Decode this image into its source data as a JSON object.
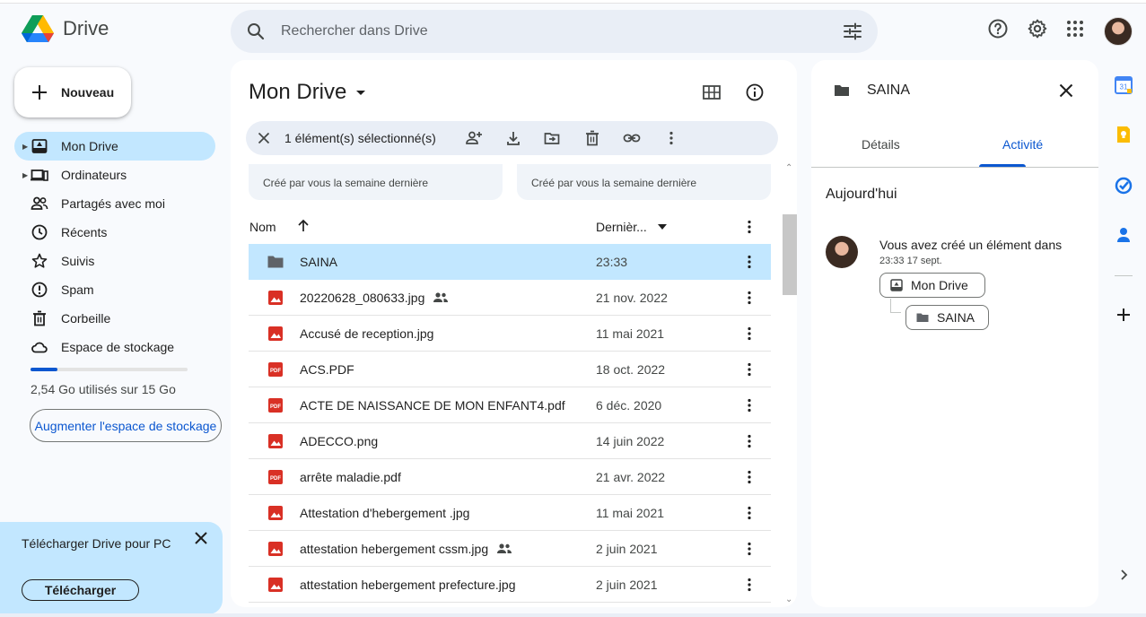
{
  "app": {
    "name": "Drive"
  },
  "search": {
    "placeholder": "Rechercher dans Drive"
  },
  "sidebar": {
    "new_label": "Nouveau",
    "items": [
      {
        "label": "Mon Drive",
        "icon": "my-drive-icon",
        "active": true,
        "expandable": true
      },
      {
        "label": "Ordinateurs",
        "icon": "computers-icon",
        "active": false,
        "expandable": true
      },
      {
        "label": "Partagés avec moi",
        "icon": "shared-icon",
        "active": false
      },
      {
        "label": "Récents",
        "icon": "clock-icon",
        "active": false
      },
      {
        "label": "Suivis",
        "icon": "star-icon",
        "active": false
      },
      {
        "label": "Spam",
        "icon": "spam-icon",
        "active": false
      },
      {
        "label": "Corbeille",
        "icon": "trash-icon",
        "active": false
      },
      {
        "label": "Espace de stockage",
        "icon": "cloud-icon",
        "active": false
      }
    ],
    "storage_used_fraction": 0.17,
    "storage_text": "2,54 Go utilisés sur 15 Go",
    "storage_button": "Augmenter l'espace de stockage"
  },
  "promo": {
    "text": "Télécharger Drive pour PC",
    "button": "Télécharger"
  },
  "main": {
    "title": "Mon Drive",
    "selection_text": "1 élément(s) sélectionné(s)",
    "cards": [
      {
        "caption": "Créé par vous la semaine dernière"
      },
      {
        "caption": "Créé par vous la semaine dernière"
      }
    ],
    "columns": {
      "name": "Nom",
      "date": "Dernièr..."
    },
    "rows": [
      {
        "name": "SAINA",
        "type": "folder",
        "date": "23:33",
        "shared": false,
        "selected": true
      },
      {
        "name": "20220628_080633.jpg",
        "type": "image",
        "date": "21 nov. 2022",
        "shared": true,
        "selected": false
      },
      {
        "name": "Accusé de reception.jpg",
        "type": "image",
        "date": "11 mai 2021",
        "shared": false,
        "selected": false
      },
      {
        "name": "ACS.PDF",
        "type": "pdf",
        "date": "18 oct. 2022",
        "shared": false,
        "selected": false
      },
      {
        "name": "ACTE DE NAISSANCE DE MON ENFANT4.pdf",
        "type": "pdf",
        "date": "6 déc. 2020",
        "shared": false,
        "selected": false
      },
      {
        "name": "ADECCO.png",
        "type": "image",
        "date": "14 juin 2022",
        "shared": false,
        "selected": false
      },
      {
        "name": "arrête maladie.pdf",
        "type": "pdf",
        "date": "21 avr. 2022",
        "shared": false,
        "selected": false
      },
      {
        "name": "Attestation d'hebergement .jpg",
        "type": "image",
        "date": "11 mai 2021",
        "shared": false,
        "selected": false
      },
      {
        "name": "attestation hebergement cssm.jpg",
        "type": "image",
        "date": "2 juin 2021",
        "shared": true,
        "selected": false
      },
      {
        "name": "attestation hebergement prefecture.jpg",
        "type": "image",
        "date": "2 juin 2021",
        "shared": false,
        "selected": false
      }
    ]
  },
  "details": {
    "title": "SAINA",
    "tabs": [
      {
        "label": "Détails",
        "active": false
      },
      {
        "label": "Activité",
        "active": true
      }
    ],
    "section": "Aujourd'hui",
    "activity": {
      "text": "Vous avez créé un élément dans",
      "time": "23:33 17 sept.",
      "parent_chip": "Mon Drive",
      "child_chip": "SAINA"
    }
  },
  "colors": {
    "accent": "#0b57d0",
    "selected_bg": "#c2e7ff",
    "image_icon": "#d93025",
    "folder_icon": "#5f6368"
  }
}
